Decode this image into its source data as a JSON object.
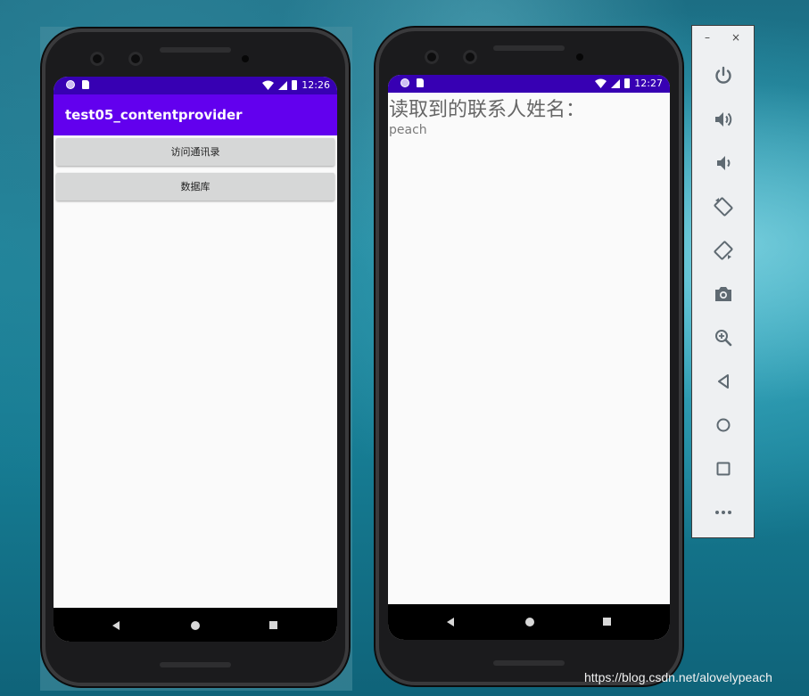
{
  "left_phone": {
    "status_time": "12:26",
    "app_title": "test05_contentprovider",
    "buttons": [
      "访问通讯录",
      "数据库"
    ]
  },
  "right_phone": {
    "status_time": "12:27",
    "heading": "读取到的联系人姓名：",
    "contact_name": "peach"
  },
  "emulator_toolbar": {
    "window_controls": {
      "minimize": "–",
      "close": "×"
    },
    "buttons": [
      {
        "name": "power",
        "icon": "power-icon"
      },
      {
        "name": "volume-up",
        "icon": "volume-up-icon"
      },
      {
        "name": "volume-down",
        "icon": "volume-down-icon"
      },
      {
        "name": "rotate-left",
        "icon": "rotate-left-icon"
      },
      {
        "name": "rotate-right",
        "icon": "rotate-right-icon"
      },
      {
        "name": "screenshot",
        "icon": "camera-icon"
      },
      {
        "name": "zoom",
        "icon": "zoom-in-icon"
      },
      {
        "name": "back",
        "icon": "back-triangle-icon"
      },
      {
        "name": "home",
        "icon": "home-circle-icon"
      },
      {
        "name": "overview",
        "icon": "overview-square-icon"
      },
      {
        "name": "more",
        "icon": "more-dots-icon"
      }
    ]
  },
  "watermark": "https://blog.csdn.net/alovelypeach",
  "colors": {
    "status_bar": "#3700b3",
    "app_bar": "#6200ee",
    "button_bg": "#d6d7d7",
    "screen_bg": "#fafafa",
    "toolbar_icon": "#5f6a72"
  }
}
